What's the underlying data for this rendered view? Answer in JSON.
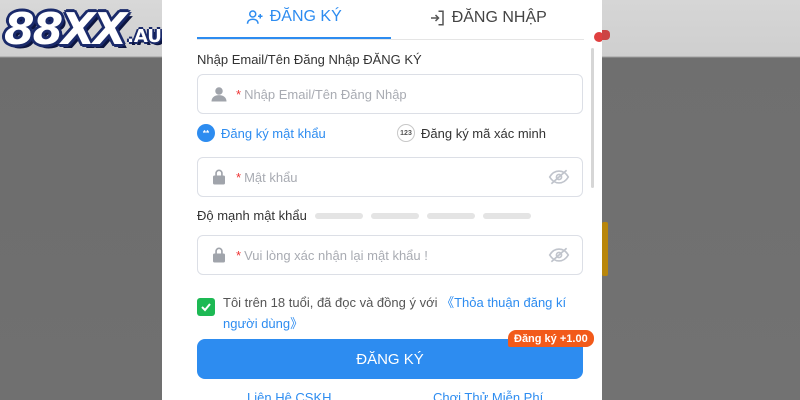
{
  "logo": {
    "main": "88XX",
    "suffix": ".AUTOS"
  },
  "tabs": [
    {
      "label": "ĐĂNG KÝ",
      "icon": "user-plus-icon",
      "active": true
    },
    {
      "label": "ĐĂNG NHẬP",
      "icon": "login-door-icon",
      "active": false
    }
  ],
  "form": {
    "account_label": "Nhập Email/Tên Đăng Nhập ĐĂNG KÝ",
    "account_required_mark": "*",
    "account_placeholder": "Nhập Email/Tên Đăng Nhập",
    "modes": [
      {
        "label": "Đăng ký mật khẩu",
        "badge": "**",
        "active": true
      },
      {
        "label": "Đăng ký mã xác minh",
        "badge": "123",
        "active": false
      }
    ],
    "password_required_mark": "*",
    "password_placeholder": "Mật khẩu",
    "strength_label": "Độ mạnh mật khẩu",
    "strength_level": 0,
    "confirm_required_mark": "*",
    "confirm_placeholder": "Vui lòng xác nhận lại mật khẩu !",
    "agree_checked": true,
    "agree_text": "Tôi trên 18 tuổi, đã đọc và đồng ý với ",
    "agree_link": "《Thỏa thuận đăng kí người dùng》",
    "submit_label": "ĐĂNG KÝ",
    "bonus_badge": "Đăng ký +1.00",
    "footer_links": [
      "Liên Hệ CSKH",
      "Chơi Thử Miễn Phí"
    ]
  },
  "colors": {
    "accent": "#2d8cf0",
    "checkbox": "#1db954",
    "bonus": "#f25a1a",
    "required": "#e33333"
  }
}
